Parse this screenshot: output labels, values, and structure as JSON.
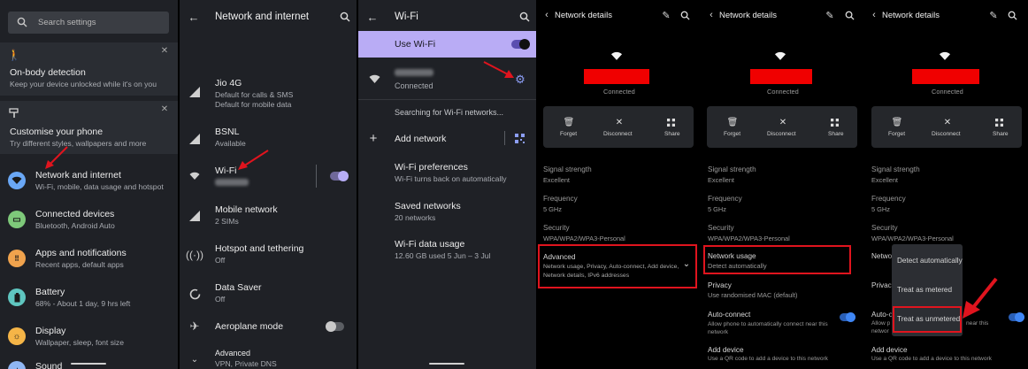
{
  "colors": {
    "accent": "#9b8cf5",
    "highlight": "#e0141e",
    "usewifi_bg": "#b9acf5",
    "toggle_blue": "#2f7bf0"
  },
  "panel1": {
    "search_placeholder": "Search settings",
    "suggestions": [
      {
        "title": "On-body detection",
        "subtitle": "Keep your device unlocked while it's on you",
        "icon": "walking-person-icon"
      },
      {
        "title": "Customise your phone",
        "subtitle": "Try different styles, wallpapers and more",
        "icon": "paint-roller-icon"
      }
    ],
    "items": [
      {
        "title": "Network and internet",
        "subtitle": "Wi-Fi, mobile, data usage and hotspot",
        "icon": "wifi-icon",
        "color": "#6aa8f6"
      },
      {
        "title": "Connected devices",
        "subtitle": "Bluetooth, Android Auto",
        "icon": "devices-icon",
        "color": "#7ec97a"
      },
      {
        "title": "Apps and notifications",
        "subtitle": "Recent apps, default apps",
        "icon": "apps-icon",
        "color": "#f0a34d"
      },
      {
        "title": "Battery",
        "subtitle": "68% - About 1 day, 9 hrs left",
        "icon": "battery-icon",
        "color": "#5fc6c0"
      },
      {
        "title": "Display",
        "subtitle": "Wallpaper, sleep, font size",
        "icon": "display-icon",
        "color": "#f5b547"
      },
      {
        "title": "Sound",
        "subtitle": "",
        "icon": "sound-icon",
        "color": "#8fb6f3"
      }
    ]
  },
  "panel2": {
    "title": "Network and internet",
    "items": [
      {
        "title": "Jio 4G",
        "subtitle": "Default for calls & SMS\nDefault for mobile data",
        "icon": "signal-icon"
      },
      {
        "title": "BSNL",
        "subtitle": "Available",
        "icon": "signal-icon"
      },
      {
        "title": "Wi-Fi",
        "subtitle": "",
        "icon": "wifi-icon"
      },
      {
        "title": "Mobile network",
        "subtitle": "2 SIMs",
        "icon": "signal-icon"
      },
      {
        "title": "Hotspot and tethering",
        "subtitle": "Off",
        "icon": "hotspot-icon"
      },
      {
        "title": "Data Saver",
        "subtitle": "Off",
        "icon": "data-saver-icon"
      },
      {
        "title": "Aeroplane mode",
        "subtitle": "",
        "icon": "airplane-icon"
      },
      {
        "title": "Advanced",
        "subtitle": "VPN, Private DNS",
        "icon": "chevron-down-icon"
      }
    ]
  },
  "panel3": {
    "title": "Wi-Fi",
    "use_wifi": "Use Wi-Fi",
    "network_status": "Connected",
    "searching": "Searching for Wi-Fi networks...",
    "add_network": "Add network",
    "items": [
      {
        "title": "Wi-Fi preferences",
        "subtitle": "Wi-Fi turns back on automatically"
      },
      {
        "title": "Saved networks",
        "subtitle": "20 networks"
      },
      {
        "title": "Wi-Fi data usage",
        "subtitle": "12.60 GB used 5 Jun – 3 Jul"
      }
    ]
  },
  "details": {
    "title": "Network details",
    "connected": "Connected",
    "actions": [
      "Forget",
      "Disconnect",
      "Share"
    ],
    "rows": [
      {
        "title": "Signal strength",
        "subtitle": "Excellent"
      },
      {
        "title": "Frequency",
        "subtitle": "5 GHz"
      },
      {
        "title": "Security",
        "subtitle": "WPA/WPA2/WPA3-Personal"
      }
    ],
    "advanced_title": "Advanced",
    "advanced_subtitle": "Network usage, Privacy, Auto-connect, Add device,\nNetwork details, IPv6 addresses",
    "network_usage_title": "Network usage",
    "network_usage_subtitle": "Detect automatically",
    "privacy_title": "Privacy",
    "privacy_subtitle": "Use randomised MAC (default)",
    "autoconnect_title": "Auto-connect",
    "autoconnect_subtitle": "Allow phone to automatically connect near this\nnetwork",
    "adddevice_title": "Add device",
    "adddevice_subtitle": "Use a QR code to add a device to this network",
    "menu_options": [
      "Detect automatically",
      "Treat as metered",
      "Treat as unmetered"
    ],
    "trunc_network": "Networ",
    "trunc_privacy": "Privacy",
    "trunc_auto": "Auto-c",
    "trunc_auto_sub1": "Allow p",
    "trunc_auto_sub2": "networ",
    "trunc_auto_tail": "near this"
  }
}
